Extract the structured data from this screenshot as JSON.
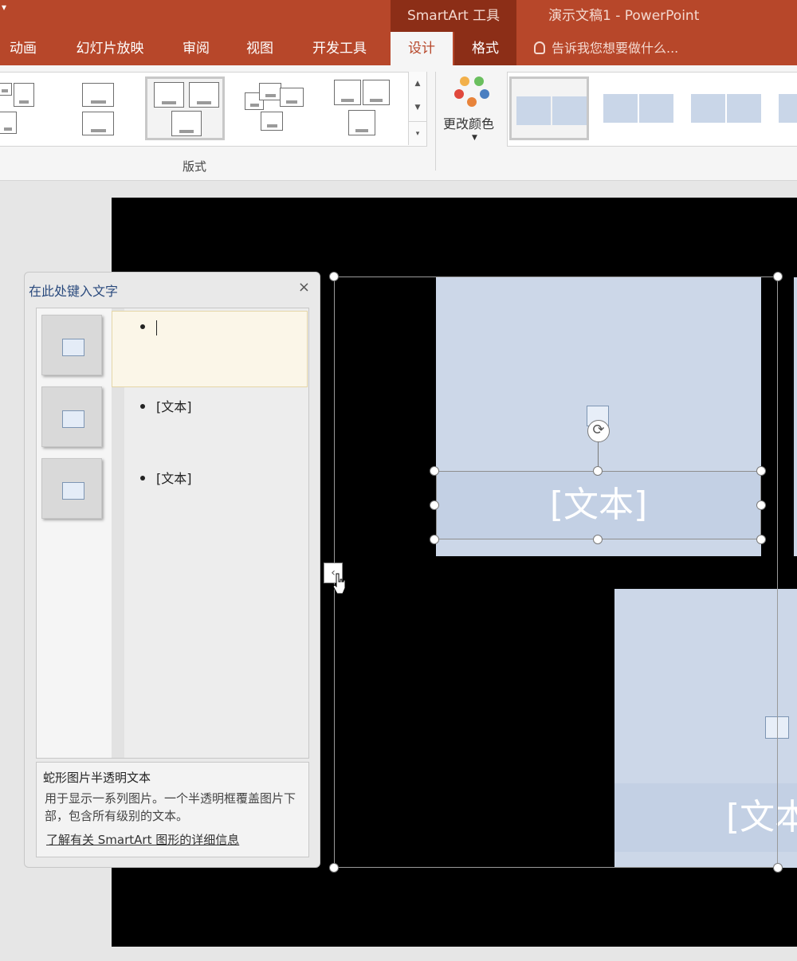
{
  "titlebar": {
    "quick_access_arrow": "▾",
    "context_tab_label": "SmartArt 工具",
    "document_title": "演示文稿1 - PowerPoint"
  },
  "tabs": [
    {
      "label": "动画",
      "active": false,
      "contextual": false
    },
    {
      "label": "幻灯片放映",
      "active": false,
      "contextual": false
    },
    {
      "label": "审阅",
      "active": false,
      "contextual": false
    },
    {
      "label": "视图",
      "active": false,
      "contextual": false
    },
    {
      "label": "开发工具",
      "active": false,
      "contextual": false
    },
    {
      "label": "设计",
      "active": true,
      "contextual": true
    },
    {
      "label": "格式",
      "active": false,
      "contextual": true
    }
  ],
  "tell_me": {
    "text": "告诉我您想要做什么..."
  },
  "ribbon": {
    "layouts_group_label": "版式",
    "change_colors_label": "更改颜色",
    "gallery_scroll": {
      "up": "▲",
      "down": "▼",
      "more": "▾"
    },
    "color_dots": [
      "#f2b04a",
      "#6abf5e",
      "#e0483c",
      "#e8833a",
      "#4a7fc1"
    ]
  },
  "smartart": {
    "shape1_caption": "[文本]",
    "shape2_caption": "[文本"
  },
  "text_pane": {
    "title": "在此处键入文字",
    "close_glyph": "×",
    "bullets": [
      "",
      "[文本]",
      "[文本]"
    ],
    "description_title": "蛇形图片半透明文本",
    "description_text": "用于显示一系列图片。一个半透明框覆盖图片下部，包含所有级别的文本。",
    "learn_more_link": "了解有关 SmartArt 图形的详细信息"
  },
  "pane_toggle_glyph": "‹",
  "colors": {
    "accent": "#b7472a",
    "context_tab": "#8c2e17",
    "shape_fill": "#ccd7e8"
  }
}
